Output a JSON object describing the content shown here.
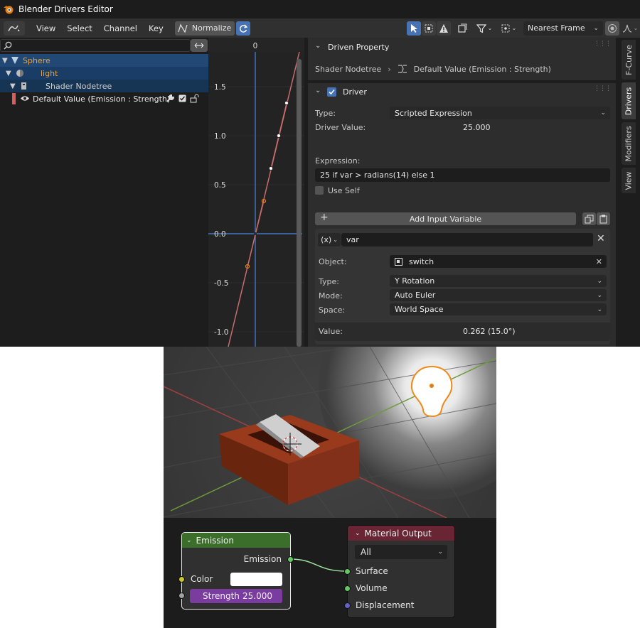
{
  "window": {
    "title": "Blender Drivers Editor"
  },
  "toolbar": {
    "menus": [
      "View",
      "Select",
      "Channel",
      "Key"
    ],
    "normalize_label": "Normalize",
    "snap_mode": "Nearest Frame"
  },
  "outliner": {
    "items": [
      {
        "label": "Sphere",
        "type": "object",
        "color": "#e8a33c"
      },
      {
        "label": "light",
        "type": "light",
        "color": "#e8a33c"
      },
      {
        "label": "Shader Nodetree",
        "type": "nodetree",
        "color": "#d0d0d0"
      },
      {
        "label": "Default Value (Emission : Strength)",
        "type": "fcurve",
        "color": "#ececec"
      }
    ]
  },
  "graph": {
    "x_tick": "0",
    "y_ticks": [
      "1.5",
      "1.0",
      "0.5",
      "0.0",
      "-0.5",
      "-1.0"
    ],
    "curve_color": "#c86c6c",
    "cursor_color": "#4477c4"
  },
  "driven_property": {
    "header": "Driven Property",
    "path_parent": "Shader Nodetree",
    "path_leaf": "Default Value (Emission : Strength)"
  },
  "driver": {
    "header": "Driver",
    "enabled": true,
    "type_label": "Type:",
    "type_value": "Scripted Expression",
    "value_label": "Driver Value:",
    "value": "25.000",
    "expression_label": "Expression:",
    "expression": "25 if var > radians(14) else 1",
    "use_self_label": "Use Self",
    "use_self": false,
    "add_variable_label": "Add Input Variable"
  },
  "variable": {
    "type_glyph": "(x)",
    "name": "var",
    "object_label": "Object:",
    "object_value": "switch",
    "type_label": "Type:",
    "type_value": "Y Rotation",
    "mode_label": "Mode:",
    "mode_value": "Auto Euler",
    "space_label": "Space:",
    "space_value": "World Space",
    "value_label": "Value:",
    "value": "0.262 (15.0°)"
  },
  "tabs": [
    "F-Curve",
    "Drivers",
    "Modifiers",
    "View"
  ],
  "active_tab": "Drivers",
  "nodes": {
    "emission": {
      "title": "Emission",
      "output_label": "Emission",
      "color_label": "Color",
      "strength_label": "Strength",
      "strength_value": "25.000",
      "header_color": "#3c6e2b"
    },
    "material_output": {
      "title": "Material Output",
      "target": "All",
      "inputs": [
        "Surface",
        "Volume",
        "Displacement"
      ],
      "header_color": "#6a2535"
    }
  },
  "colors": {
    "accent_blue": "#4772b3",
    "selection_row": "#224876",
    "strength_field": "#7a3c9e",
    "fcurve_swatch": "#e05a5a"
  }
}
